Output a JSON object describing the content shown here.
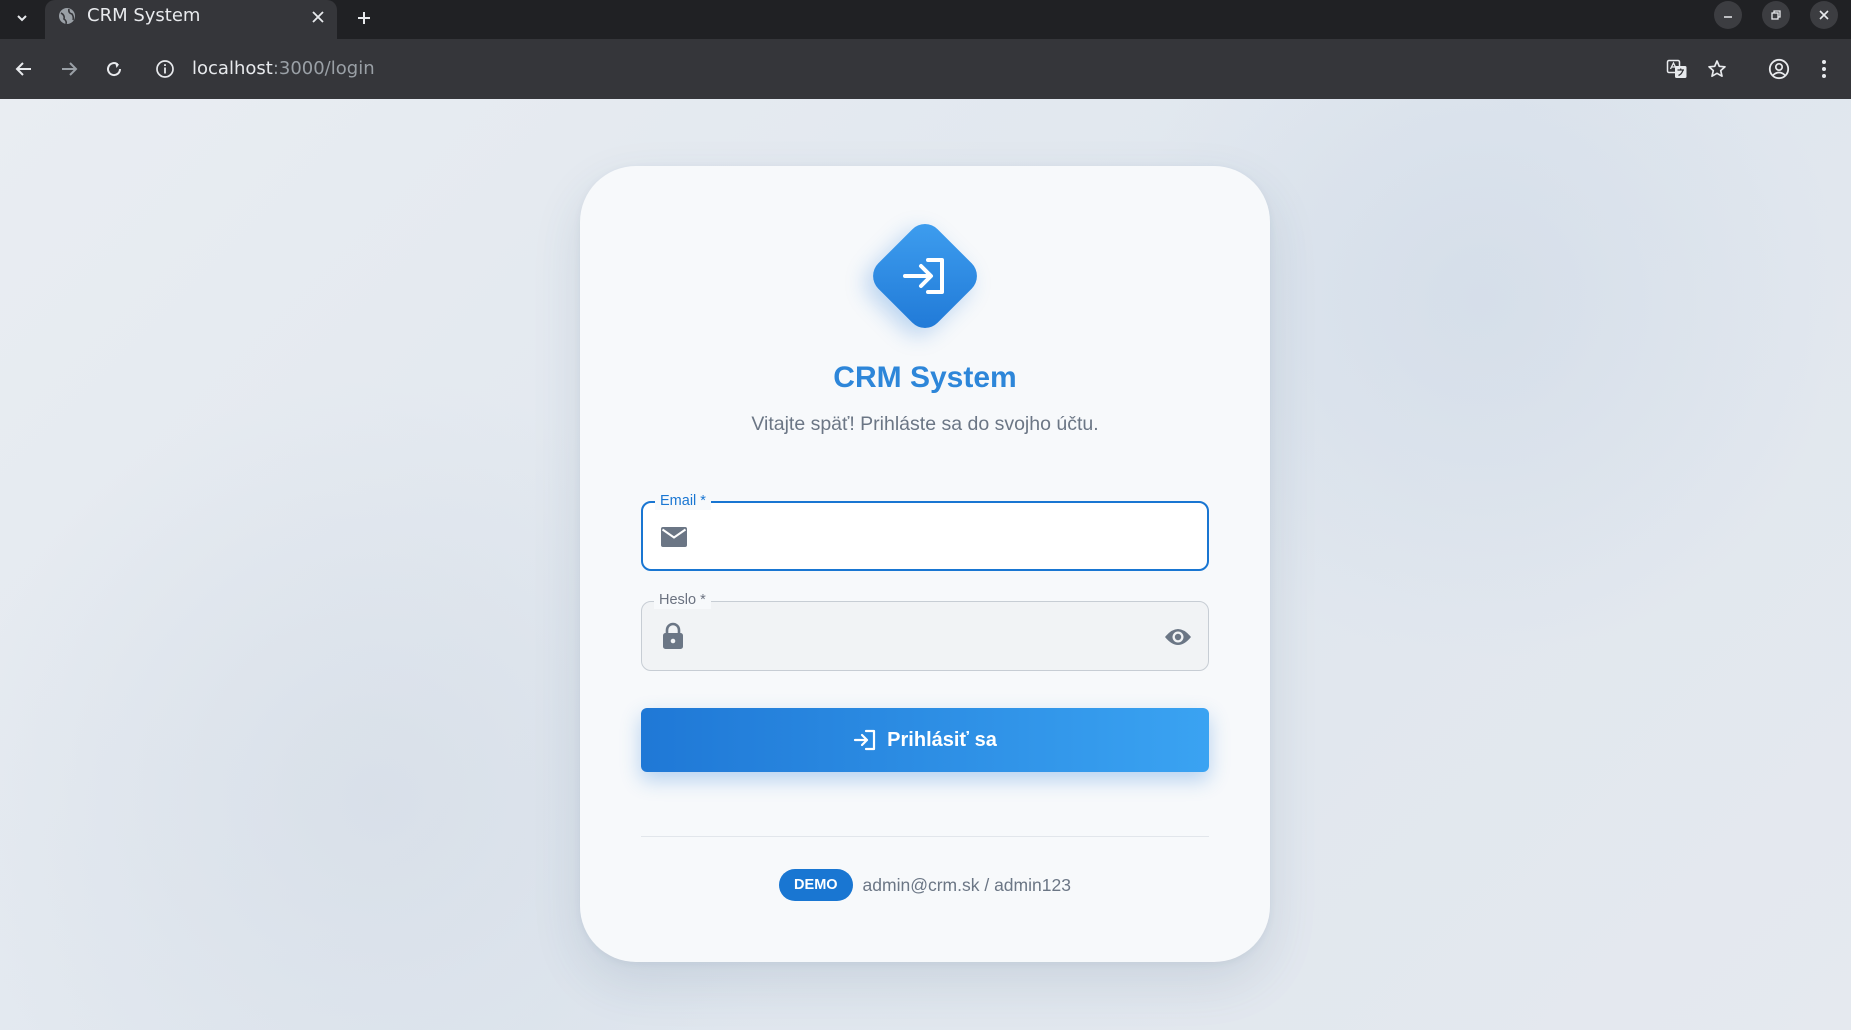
{
  "browser": {
    "tab_title": "CRM System",
    "url_host": "localhost",
    "url_path": ":3000/login"
  },
  "login": {
    "title": "CRM System",
    "subtitle": "Vitajte späť! Prihláste sa do svojho účtu.",
    "email_label": "Email *",
    "email_value": "",
    "password_label": "Heslo *",
    "password_value": "",
    "submit_label": "Prihlásiť sa",
    "demo_badge": "DEMO",
    "demo_credentials": "admin@crm.sk / admin123"
  },
  "colors": {
    "accent": "#1976d2",
    "title": "#2d86d9"
  },
  "icons": [
    "globe-icon",
    "close-icon",
    "plus-icon",
    "back-icon",
    "forward-icon",
    "reload-icon",
    "info-icon",
    "translate-icon",
    "star-icon",
    "profile-icon",
    "menu-icon",
    "login-icon",
    "mail-icon",
    "lock-icon",
    "eye-icon"
  ]
}
